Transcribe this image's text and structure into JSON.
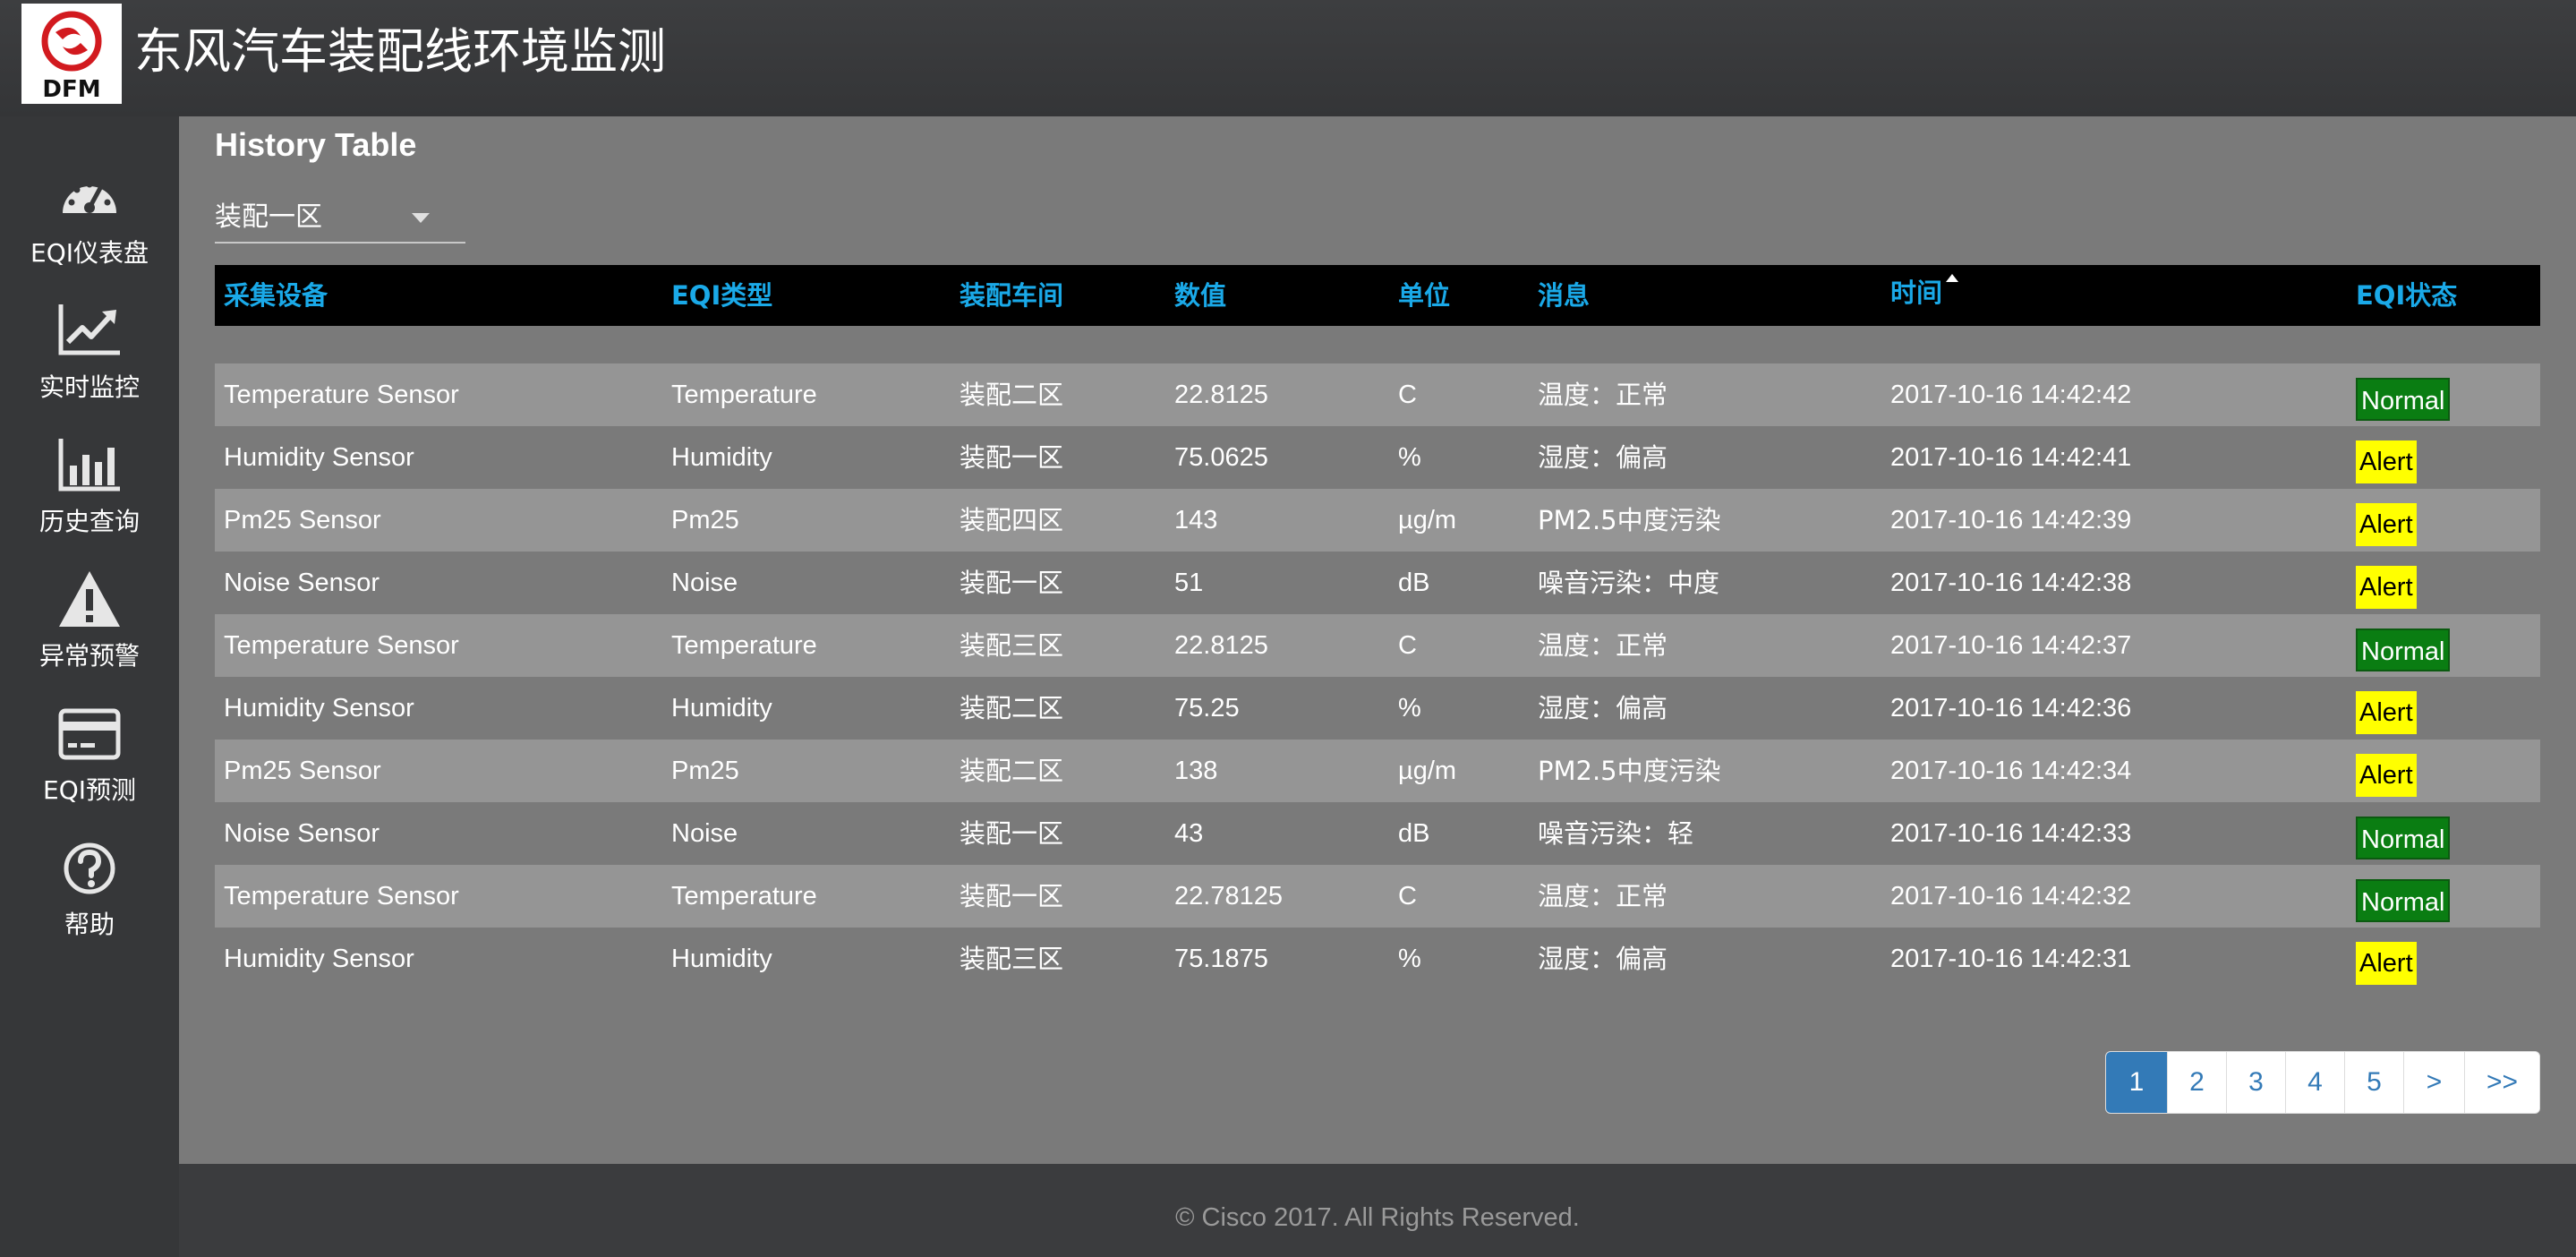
{
  "header": {
    "logo_text": "DFM",
    "title": "东风汽车装配线环境监测"
  },
  "sidebar": {
    "items": [
      {
        "label": "EQI仪表盘",
        "icon": "dashboard-gauge-icon"
      },
      {
        "label": "实时监控",
        "icon": "line-chart-icon"
      },
      {
        "label": "历史查询",
        "icon": "bar-chart-icon"
      },
      {
        "label": "异常预警",
        "icon": "warning-icon"
      },
      {
        "label": "EQI预测",
        "icon": "credit-card-icon"
      },
      {
        "label": "帮助",
        "icon": "help-icon"
      }
    ]
  },
  "main": {
    "title": "History Table",
    "zone_select": {
      "value": "装配一区"
    },
    "columns": [
      "采集设备",
      "EQI类型",
      "装配车间",
      "数值",
      "单位",
      "消息",
      "时间",
      "EQI状态"
    ],
    "rows": [
      {
        "device": "Temperature Sensor",
        "type": "Temperature",
        "zone": "装配二区",
        "value": "22.8125",
        "unit": "C",
        "message": "温度：正常",
        "time": "2017-10-16 14:42:42",
        "status": "Normal"
      },
      {
        "device": "Humidity Sensor",
        "type": "Humidity",
        "zone": "装配一区",
        "value": "75.0625",
        "unit": "%",
        "message": "湿度：偏高",
        "time": "2017-10-16 14:42:41",
        "status": "Alert"
      },
      {
        "device": "Pm25 Sensor",
        "type": "Pm25",
        "zone": "装配四区",
        "value": "143",
        "unit": "µg/m",
        "message": "PM2.5中度污染",
        "time": "2017-10-16 14:42:39",
        "status": "Alert"
      },
      {
        "device": "Noise Sensor",
        "type": "Noise",
        "zone": "装配一区",
        "value": "51",
        "unit": "dB",
        "message": "噪音污染：中度",
        "time": "2017-10-16 14:42:38",
        "status": "Alert"
      },
      {
        "device": "Temperature Sensor",
        "type": "Temperature",
        "zone": "装配三区",
        "value": "22.8125",
        "unit": "C",
        "message": "温度：正常",
        "time": "2017-10-16 14:42:37",
        "status": "Normal"
      },
      {
        "device": "Humidity Sensor",
        "type": "Humidity",
        "zone": "装配二区",
        "value": "75.25",
        "unit": "%",
        "message": "湿度：偏高",
        "time": "2017-10-16 14:42:36",
        "status": "Alert"
      },
      {
        "device": "Pm25 Sensor",
        "type": "Pm25",
        "zone": "装配二区",
        "value": "138",
        "unit": "µg/m",
        "message": "PM2.5中度污染",
        "time": "2017-10-16 14:42:34",
        "status": "Alert"
      },
      {
        "device": "Noise Sensor",
        "type": "Noise",
        "zone": "装配一区",
        "value": "43",
        "unit": "dB",
        "message": "噪音污染：轻",
        "time": "2017-10-16 14:42:33",
        "status": "Normal"
      },
      {
        "device": "Temperature Sensor",
        "type": "Temperature",
        "zone": "装配一区",
        "value": "22.78125",
        "unit": "C",
        "message": "温度：正常",
        "time": "2017-10-16 14:42:32",
        "status": "Normal"
      },
      {
        "device": "Humidity Sensor",
        "type": "Humidity",
        "zone": "装配三区",
        "value": "75.1875",
        "unit": "%",
        "message": "湿度：偏高",
        "time": "2017-10-16 14:42:31",
        "status": "Alert"
      }
    ],
    "pagination": {
      "pages": [
        "1",
        "2",
        "3",
        "4",
        "5",
        ">",
        ">>"
      ],
      "active": "1"
    }
  },
  "footer": {
    "text": "© Cisco 2017. All Rights Reserved."
  },
  "colors": {
    "header_link": "#1aa9e8",
    "normal_badge": "#0a7d12",
    "alert_badge": "#ffff00",
    "active_page": "#337ab7"
  }
}
